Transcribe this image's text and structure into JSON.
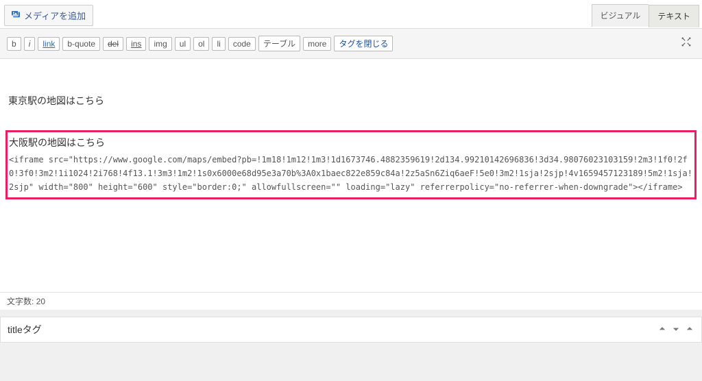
{
  "topbar": {
    "add_media_label": "メディアを追加"
  },
  "tabs": {
    "visual": "ビジュアル",
    "text": "テキスト"
  },
  "toolbar": {
    "b": "b",
    "i": "i",
    "link": "link",
    "bquote": "b-quote",
    "del": "del",
    "ins": "ins",
    "img": "img",
    "ul": "ul",
    "ol": "ol",
    "li": "li",
    "code": "code",
    "table": "テーブル",
    "more": "more",
    "close_tags": "タグを閉じる"
  },
  "content": {
    "line1": "東京駅の地図はこちら",
    "line2": "大阪駅の地図はこちら",
    "iframe_code": "<iframe src=\"https://www.google.com/maps/embed?pb=!1m18!1m12!1m3!1d1673746.4882359619!2d134.99210142696836!3d34.98076023103159!2m3!1f0!2f0!3f0!3m2!1i1024!2i768!4f13.1!3m3!1m2!1s0x6000e68d95e3a70b%3A0x1baec822e859c84a!2z5aSn6Ziq6aeF!5e0!3m2!1sja!2sjp!4v1659457123189!5m2!1sja!2sjp\" width=\"800\" height=\"600\" style=\"border:0;\" allowfullscreen=\"\" loading=\"lazy\" referrerpolicy=\"no-referrer-when-downgrade\"></iframe>"
  },
  "footer": {
    "word_count_label": "文字数:",
    "word_count_value": "20"
  },
  "metabox": {
    "title": "titleタグ"
  }
}
